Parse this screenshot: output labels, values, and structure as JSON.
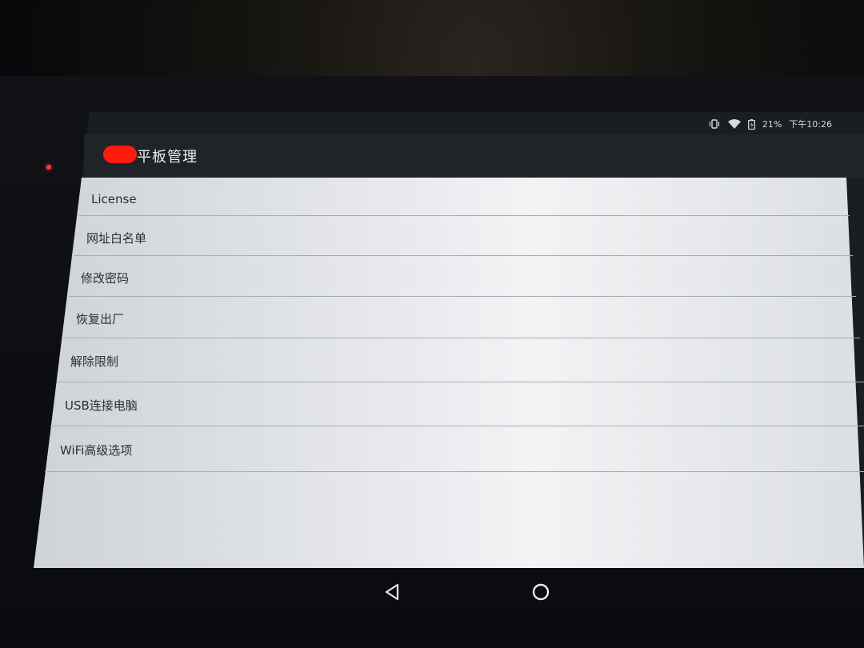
{
  "status_bar": {
    "battery_percent": "21%",
    "time": "下午10:26",
    "icons": [
      "vibrate-icon",
      "wifi-icon",
      "battery-icon"
    ]
  },
  "app": {
    "title": "平板管理",
    "logo_color": "#ff1a10"
  },
  "settings_list": [
    {
      "label": "License"
    },
    {
      "label": "网址白名单"
    },
    {
      "label": "修改密码"
    },
    {
      "label": "恢复出厂"
    },
    {
      "label": "解除限制"
    },
    {
      "label": "USB连接电脑"
    },
    {
      "label": "WiFi高级选项"
    }
  ],
  "nav_bar": {
    "icons": [
      "back-icon",
      "home-icon"
    ]
  }
}
